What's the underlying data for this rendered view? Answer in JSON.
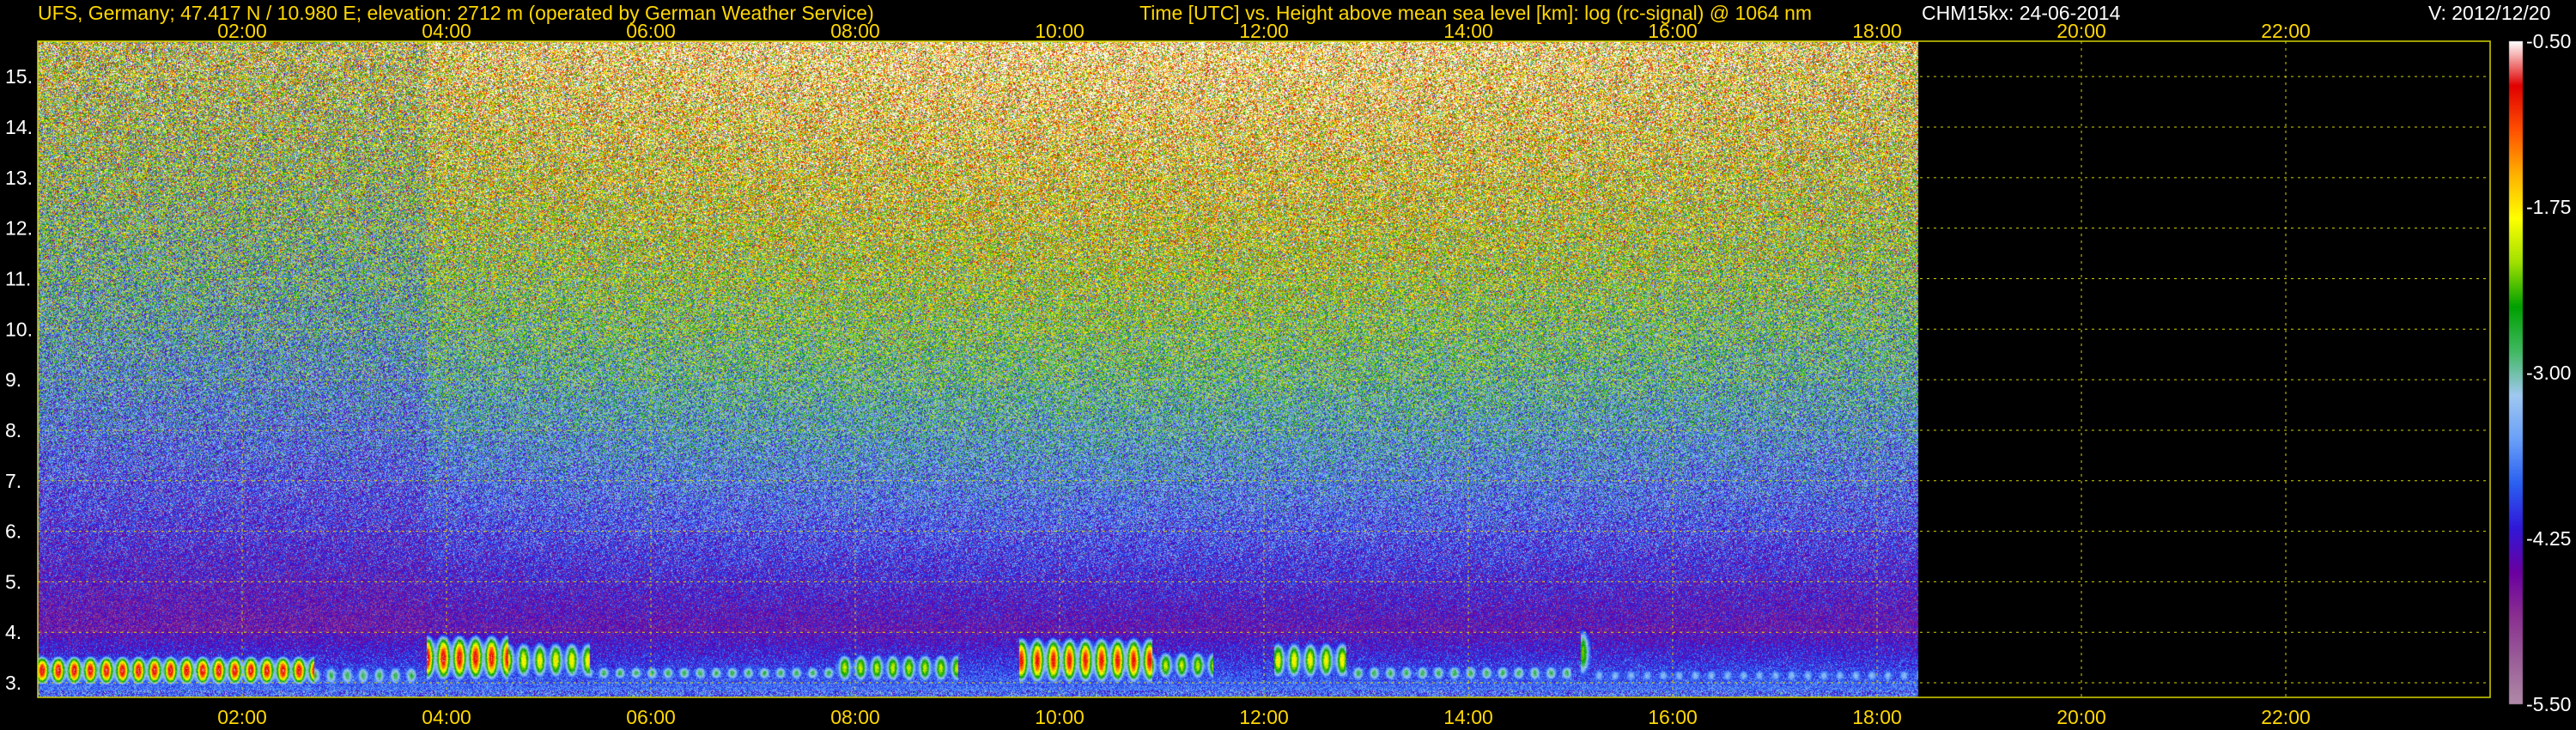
{
  "chart_data": {
    "type": "heatmap",
    "header": {
      "station": "UFS, Germany; 47.417 N / 10.980 E; elevation: 2712 m  (operated by German Weather Service)",
      "plot_description": "Time [UTC] vs. Height above mean sea level [km]: log (rc-signal) @ 1064 nm",
      "instrument_date": "CHM15kx: 24-06-2014",
      "version": "V: 2012/12/20"
    },
    "x_axis": {
      "unit": "hours UTC",
      "range": [
        0,
        24
      ],
      "ticks": [
        2,
        4,
        6,
        8,
        10,
        12,
        14,
        16,
        18,
        20,
        22
      ],
      "tick_labels": [
        "02:00",
        "04:00",
        "06:00",
        "08:00",
        "10:00",
        "12:00",
        "14:00",
        "16:00",
        "18:00",
        "20:00",
        "22:00"
      ]
    },
    "y_axis": {
      "unit": "km",
      "range": [
        2.712,
        15.7
      ],
      "ticks": [
        3,
        4,
        5,
        6,
        7,
        8,
        9,
        10,
        11,
        12,
        13,
        14,
        15
      ],
      "tick_labels": [
        "3.",
        "4.",
        "5.",
        "6.",
        "7.",
        "8.",
        "9.",
        "10.",
        "11.",
        "12.",
        "13.",
        "14.",
        "15."
      ]
    },
    "data_end_hour": 18.4,
    "grid": true,
    "colorbar": {
      "range": [
        -5.5,
        -0.5
      ],
      "ticks": [
        -0.5,
        -1.75,
        -3.0,
        -4.25,
        -5.5
      ],
      "tick_labels": [
        "-0.50",
        "-1.75",
        "-3.00",
        "-4.25",
        "-5.50"
      ],
      "colors": [
        "#b08aa8",
        "#9a5f98",
        "#8a2f90",
        "#6a00a0",
        "#3018d8",
        "#2a60f0",
        "#6aa0f8",
        "#a0c8f0",
        "#40b860",
        "#00a000",
        "#a0e000",
        "#ffff00",
        "#ffb000",
        "#ff5000",
        "#e00000",
        "#ffffff"
      ]
    },
    "colors": {
      "header_text": "#ffd700",
      "tick_text": "#ffd700",
      "grid": "#d4d400",
      "background": "#000000"
    }
  }
}
